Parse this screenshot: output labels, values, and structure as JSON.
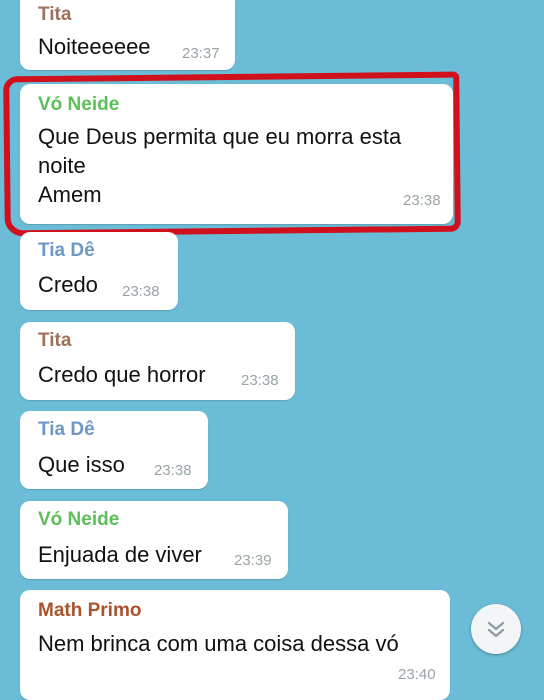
{
  "colors": {
    "background": "#6bbcd6",
    "bubble": "#ffffff",
    "timestamp": "#9aa4a8",
    "highlight": "#d0101c"
  },
  "messages": [
    {
      "sender": "Tita",
      "sender_color": "#a0715a",
      "text": "Noiteeeeee",
      "time": "23:37"
    },
    {
      "sender": "Vó Neide",
      "sender_color": "#5cbf5a",
      "text": "Que Deus permita que eu morra esta\nnoite\nAmem",
      "time": "23:38"
    },
    {
      "sender": "Tia Dê",
      "sender_color": "#6d98c6",
      "text": "Credo",
      "time": "23:38"
    },
    {
      "sender": "Tita",
      "sender_color": "#a0715a",
      "text": "Credo que horror",
      "time": "23:38"
    },
    {
      "sender": "Tia Dê",
      "sender_color": "#6d98c6",
      "text": "Que isso",
      "time": "23:38"
    },
    {
      "sender": "Vó Neide",
      "sender_color": "#5cbf5a",
      "text": "Enjuada de viver",
      "time": "23:39"
    },
    {
      "sender": "Math Primo",
      "sender_color": "#a8552e",
      "text": "Nem brinca com uma coisa dessa vó",
      "time": "23:40"
    }
  ],
  "scroll_button": {
    "icon": "double-chevron-down-icon"
  }
}
